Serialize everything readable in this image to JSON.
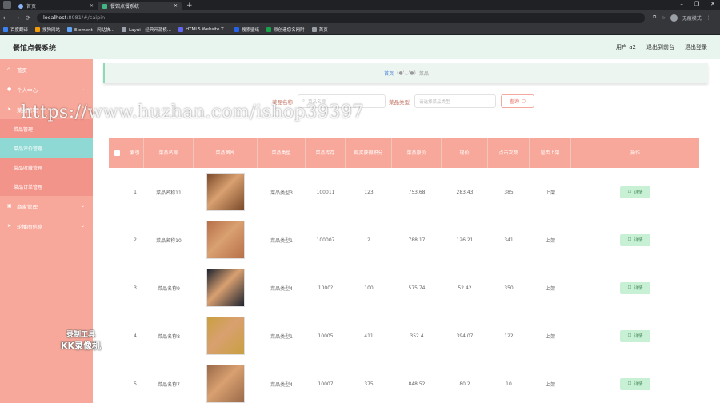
{
  "browser": {
    "tabs": [
      {
        "label": "首页",
        "active": false
      },
      {
        "label": "餐馆点餐系统",
        "active": true
      }
    ],
    "url_host": "localhost",
    "url_path": ":8081/#/caipin",
    "profile_label": "无痕模式",
    "bookmarks": [
      {
        "label": "百度翻译",
        "color": "#3b82f6"
      },
      {
        "label": "搜狗网站",
        "color": "#f59e0b"
      },
      {
        "label": "Element - 网站快...",
        "color": "#60a5fa"
      },
      {
        "label": "Layui - 经典开源模...",
        "color": "#9ca3af"
      },
      {
        "label": "HTML5 Website T...",
        "color": "#6366f1"
      },
      {
        "label": "搜索壁纸",
        "color": "#2563eb"
      },
      {
        "label": "原创造您名网附",
        "color": "#16a34a"
      },
      {
        "label": "首页",
        "color": "#9aa0a6"
      }
    ]
  },
  "header": {
    "title": "餐馆点餐系统",
    "user": "用户 a2",
    "back_to_front": "退出到前台",
    "logout": "退出登录"
  },
  "sidebar": {
    "items": [
      {
        "label": "首页",
        "icon": "home-icon"
      },
      {
        "label": "个人中心",
        "icon": "user-icon"
      },
      {
        "label": "菜品管理",
        "icon": "send-icon"
      },
      {
        "label": "商家管理",
        "icon": "shop-icon"
      },
      {
        "label": "轮播图信息",
        "icon": "send-icon"
      }
    ],
    "sub_items": [
      {
        "label": "菜品管理",
        "active": false
      },
      {
        "label": "菜品评价管理",
        "active": true
      },
      {
        "label": "菜品收藏管理",
        "active": false
      },
      {
        "label": "菜品订单管理",
        "active": false
      }
    ]
  },
  "breadcrumb": {
    "home": "首页",
    "separator": "(●'◡'●)",
    "current": "菜品"
  },
  "search": {
    "name_label": "菜品名称",
    "name_placeholder": "菜品名称",
    "type_label": "菜品类型",
    "type_placeholder": "请选择菜品类型",
    "query_label": "查询"
  },
  "table": {
    "headers": [
      "索引",
      "菜品名称",
      "菜品图片",
      "菜品类型",
      "菜品库存",
      "购买获得积分",
      "菜品原价",
      "现价",
      "点击次数",
      "是否上架",
      "操作"
    ],
    "detail_label": "详情",
    "rows": [
      {
        "index": "1",
        "name": "菜品名称11",
        "image_color": "#7a4a2a",
        "type": "菜品类型3",
        "stock": "100011",
        "points": "123",
        "original_price": "753.68",
        "price": "283.43",
        "clicks": "385",
        "on_shelf": "上架"
      },
      {
        "index": "2",
        "name": "菜品名称10",
        "image_color": "#b8704a",
        "type": "菜品类型1",
        "stock": "100007",
        "points": "2",
        "original_price": "788.17",
        "price": "126.21",
        "clicks": "341",
        "on_shelf": "上架"
      },
      {
        "index": "3",
        "name": "菜品名称9",
        "image_color": "#1e2430",
        "type": "菜品类型4",
        "stock": "1000?",
        "points": "100",
        "original_price": "575.74",
        "price": "52.42",
        "clicks": "350",
        "on_shelf": "上架"
      },
      {
        "index": "4",
        "name": "菜品名称8",
        "image_color": "#c9a040",
        "type": "菜品类型1",
        "stock": "10005",
        "points": "411",
        "original_price": "352.4",
        "price": "394.07",
        "clicks": "122",
        "on_shelf": "上架"
      },
      {
        "index": "5",
        "name": "菜品名称7",
        "image_color": "#9a6a4a",
        "type": "菜品类型4",
        "stock": "10007",
        "points": "375",
        "original_price": "848.52",
        "price": "80.2",
        "clicks": "10",
        "on_shelf": "上架"
      }
    ]
  },
  "watermark": {
    "url": "https://www.huzhan.com/ishop39397",
    "rec_line1": "录制工具",
    "rec_line2": "KK录像机"
  }
}
